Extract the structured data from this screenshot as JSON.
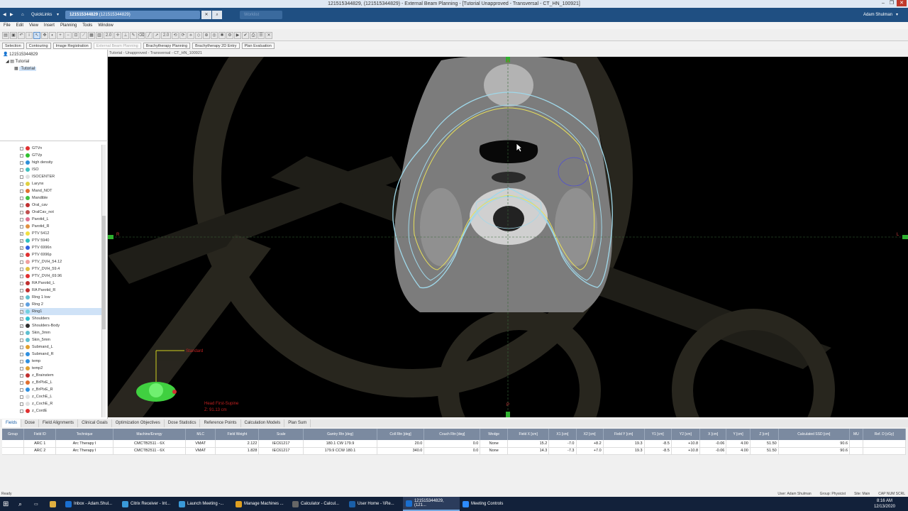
{
  "window": {
    "title": "121515344829, (121515344829) - External Beam Planning - [Tutorial  Unapproved - Transversal - CT_HN_100921]"
  },
  "navbar": {
    "quicklinks": "QuickLinks",
    "patient_tab": "121515344829",
    "patient_tab_sub": "(121515344829)",
    "ghost_tab": "Worklist",
    "user": "Adam Shulman"
  },
  "menu": [
    "File",
    "Edit",
    "View",
    "Insert",
    "Planning",
    "Tools",
    "Window"
  ],
  "toolbar": {
    "zoom1": "2.0",
    "zoom2": "2.0"
  },
  "workspaces": [
    "Selection",
    "Contouring",
    "Image Registration",
    "External Beam Planning",
    "Brachytherapy Planning",
    "Brachytherapy 2D Entry",
    "Plan Evaluation"
  ],
  "tree": {
    "patient": "121515344829",
    "course": "Tutorial",
    "plan": "Tutorial"
  },
  "viewer": {
    "title": "Tutorial - Unapproved - Transversal - CT_HN_100921",
    "orient_label": "Standard",
    "patient_orientation": "Head First-Supine",
    "slice_z": "Z: 91.13 cm",
    "top_marker": "A",
    "left_marker": "R",
    "right_marker": "L",
    "bottom_marker": "P"
  },
  "structures": [
    {
      "name": "GTVn",
      "color": "#e03030",
      "checked": false
    },
    {
      "name": "GTVp",
      "color": "#30c030",
      "checked": false
    },
    {
      "name": "high density",
      "color": "#2f8fd8",
      "checked": false
    },
    {
      "name": "ISO",
      "color": "#40c0c0",
      "checked": false
    },
    {
      "name": "ISOCENTER",
      "color": "#e0e0e0",
      "checked": false
    },
    {
      "name": "Larynx",
      "color": "#e0d040",
      "checked": false
    },
    {
      "name": "Mand_NOT",
      "color": "#e07030",
      "checked": false
    },
    {
      "name": "Mandible",
      "color": "#40c040",
      "checked": false
    },
    {
      "name": "Oral_cav",
      "color": "#c03030",
      "checked": false
    },
    {
      "name": "OralCav_not",
      "color": "#c05050",
      "checked": false
    },
    {
      "name": "Parotid_L",
      "color": "#e07090",
      "checked": false
    },
    {
      "name": "Parotid_R",
      "color": "#e09040",
      "checked": false
    },
    {
      "name": "PTV 5412",
      "color": "#f0e040",
      "checked": true
    },
    {
      "name": "PTV 5940",
      "color": "#30c0c0",
      "checked": true
    },
    {
      "name": "PTV 6996n",
      "color": "#3060e0",
      "checked": true
    },
    {
      "name": "PTV 6996p",
      "color": "#e03030",
      "checked": true
    },
    {
      "name": "PTV_DVH_54.12",
      "color": "#f0a0a0",
      "checked": false
    },
    {
      "name": "PTV_DVH_59.4",
      "color": "#e0c040",
      "checked": false
    },
    {
      "name": "PTV_DVH_69.96",
      "color": "#e03030",
      "checked": false
    },
    {
      "name": "RA Parotid_L",
      "color": "#c03030",
      "checked": false
    },
    {
      "name": "RA Parotid_R",
      "color": "#c03030",
      "checked": false
    },
    {
      "name": "Ring 1 low",
      "color": "#60c0d0",
      "checked": true
    },
    {
      "name": "Ring 2",
      "color": "#60a0e0",
      "checked": false
    },
    {
      "name": "Ring1",
      "color": "#70d0e0",
      "checked": true,
      "selected": true
    },
    {
      "name": "Shoulders",
      "color": "#30c0d0",
      "checked": true
    },
    {
      "name": "Shoulders-Body",
      "color": "#303030",
      "checked": true
    },
    {
      "name": "Skin_3mm",
      "color": "#60c0d0",
      "checked": false
    },
    {
      "name": "Skin_5mm",
      "color": "#60c0d0",
      "checked": false
    },
    {
      "name": "Submand_L",
      "color": "#e0a030",
      "checked": false
    },
    {
      "name": "Submand_R",
      "color": "#3090e0",
      "checked": false
    },
    {
      "name": "temp",
      "color": "#3090e0",
      "checked": false
    },
    {
      "name": "temp2",
      "color": "#e0a030",
      "checked": false
    },
    {
      "name": "z_Brainstem",
      "color": "#c03030",
      "checked": false
    },
    {
      "name": "z_BrPlxE_L",
      "color": "#e07030",
      "checked": false
    },
    {
      "name": "z_BrPlxE_R",
      "color": "#3090e0",
      "checked": false
    },
    {
      "name": "z_CochE_L",
      "color": "#e0e0e0",
      "checked": false
    },
    {
      "name": "z_CochE_R",
      "color": "#e0e0e0",
      "checked": false
    },
    {
      "name": "z_CordE",
      "color": "#e03030",
      "checked": false
    }
  ],
  "bottom_tabs": [
    "Fields",
    "Dose",
    "Field Alignments",
    "Clinical Goals",
    "Optimization Objectives",
    "Dose Statistics",
    "Reference Points",
    "Calculation Models",
    "Plan Sum"
  ],
  "field_table": {
    "headers": [
      "Group",
      "Field ID",
      "Technique",
      "Machine/Energy",
      "MLC",
      "Field Weight",
      "Scale",
      "Gantry Rtn [deg]",
      "Coll Rtn [deg]",
      "Couch Rtn [deg]",
      "Wedge",
      "Field X [cm]",
      "X1 [cm]",
      "X2 [cm]",
      "Field Y [cm]",
      "Y1 [cm]",
      "Y2 [cm]",
      "X [cm]",
      "Y [cm]",
      "Z [cm]",
      "Calculated SSD [cm]",
      "MU",
      "Ref. D [cGy]"
    ],
    "rows": [
      [
        "",
        "ARC 1",
        "Arc Therapy I",
        "CMCTB2511 - 6X",
        "VMAT",
        "2.122",
        "IEC61217",
        "180.1 CW 179.9",
        "20.0",
        "0.0",
        "None",
        "15.2",
        "-7.0",
        "+8.2",
        "19.3",
        "-8.5",
        "+10.8",
        "-0.06",
        "4.00",
        "51.50",
        "90.6",
        "",
        ""
      ],
      [
        "",
        "ARC 2",
        "Arc Therapy I",
        "CMCTB2511 - 6X",
        "VMAT",
        "1.828",
        "IEC61217",
        "179.9 CCW 180.1",
        "340.0",
        "0.0",
        "None",
        "14.3",
        "-7.3",
        "+7.0",
        "19.3",
        "-8.5",
        "+10.8",
        "-0.06",
        "4.00",
        "51.50",
        "90.6",
        "",
        ""
      ]
    ]
  },
  "status": {
    "left": "Ready",
    "user": "User: Adam Shulman",
    "group": "Group: Physicist",
    "site": "Site: Main",
    "caps": "CAP NUM SCRL"
  },
  "taskbar": [
    {
      "label": "Inbox - Adam.Shul...",
      "color": "#1a6fd0"
    },
    {
      "label": "Citrix Receiver - Int...",
      "color": "#3a9ad9"
    },
    {
      "label": "Launch Meeting -...",
      "color": "#3a9ad9"
    },
    {
      "label": "Manage Machines ...",
      "color": "#e0a020"
    },
    {
      "label": "Calculator - Calcul...",
      "color": "#666666"
    },
    {
      "label": "User Home - \\\\Re...",
      "color": "#1a5fa8"
    },
    {
      "label": "121515344829, (121...",
      "color": "#1a6fd0",
      "active": true
    },
    {
      "label": "Meeting Controls",
      "color": "#2d8cff"
    }
  ],
  "clock": {
    "time": "8:16 AM",
    "date": "12/13/2020"
  }
}
